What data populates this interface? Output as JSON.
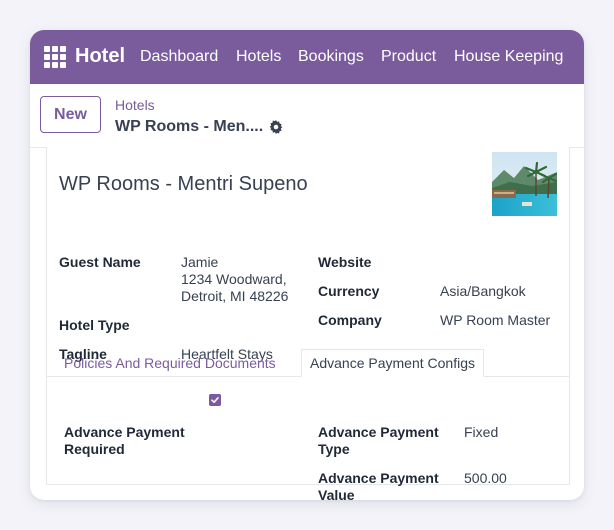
{
  "navbar": {
    "brand": "Hotel",
    "menu": [
      "Dashboard",
      "Hotels",
      "Bookings",
      "Product",
      "House Keeping"
    ]
  },
  "controls": {
    "new_label": "New",
    "breadcrumb_parent": "Hotels",
    "breadcrumb_current": "WP Rooms - Men...."
  },
  "record": {
    "title": "WP Rooms - Mentri Supeno",
    "fields_left": {
      "guest_name_label": "Guest Name",
      "guest_name_line1": "Jamie",
      "guest_name_line2": "1234 Woodward,",
      "guest_name_line3": "Detroit, MI 48226",
      "hotel_type_label": "Hotel Type",
      "tagline_label": "Tagline",
      "tagline_value": "Heartfelt Stays"
    },
    "fields_right": {
      "website_label": "Website",
      "currency_label": "Currency",
      "currency_value": "Asia/Bangkok",
      "company_label": "Company",
      "company_value": "WP Room Master"
    }
  },
  "tabs": {
    "policies": "Policies And Required Documents",
    "advance": "Advance Payment Configs"
  },
  "advance": {
    "required_label_1": "Advance Payment",
    "required_label_2": "Required",
    "required_checked": true,
    "type_label_1": "Advance Payment",
    "type_label_2": "Type",
    "type_value": "Fixed",
    "value_label_1": "Advance Payment",
    "value_label_2": "Value",
    "value_value": "500.00"
  },
  "colors": {
    "brand": "#7a5c9c",
    "background": "#f3f3f9",
    "text": "#374151"
  }
}
